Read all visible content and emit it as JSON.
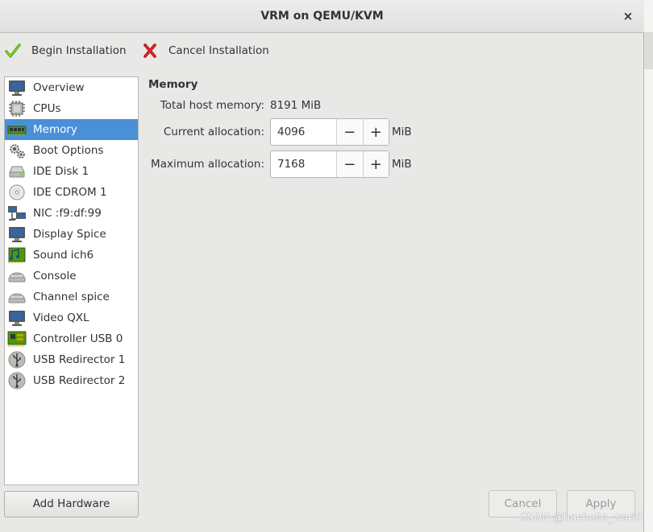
{
  "window": {
    "title": "VRM on QEMU/KVM",
    "close_glyph": "×"
  },
  "toolbar": {
    "begin_label": "Begin Installation",
    "cancel_label": "Cancel Installation",
    "begin_icon": "green-checkmark-icon",
    "cancel_icon": "red-x-icon"
  },
  "sidebar": {
    "items": [
      {
        "label": "Overview",
        "icon": "monitor-icon"
      },
      {
        "label": "CPUs",
        "icon": "cpu-chip-icon"
      },
      {
        "label": "Memory",
        "icon": "memory-module-icon",
        "selected": true
      },
      {
        "label": "Boot Options",
        "icon": "gears-icon"
      },
      {
        "label": "IDE Disk 1",
        "icon": "hard-disk-icon"
      },
      {
        "label": "IDE CDROM 1",
        "icon": "cdrom-icon"
      },
      {
        "label": "NIC :f9:df:99",
        "icon": "network-icon"
      },
      {
        "label": "Display Spice",
        "icon": "display-icon"
      },
      {
        "label": "Sound ich6",
        "icon": "sound-card-icon"
      },
      {
        "label": "Console",
        "icon": "serial-console-icon"
      },
      {
        "label": "Channel spice",
        "icon": "channel-icon"
      },
      {
        "label": "Video QXL",
        "icon": "video-monitor-icon"
      },
      {
        "label": "Controller USB 0",
        "icon": "controller-card-icon"
      },
      {
        "label": "USB Redirector 1",
        "icon": "usb-icon"
      },
      {
        "label": "USB Redirector 2",
        "icon": "usb-icon"
      }
    ],
    "selected_color": "#4a90d9",
    "add_hardware_label": "Add Hardware"
  },
  "memory": {
    "section_title": "Memory",
    "total_label": "Total host memory:",
    "total_value": "8191 MiB",
    "current_label": "Current allocation:",
    "current_value": "4096",
    "maximum_label": "Maximum allocation:",
    "maximum_value": "7168",
    "unit": "MiB",
    "minus_glyph": "−",
    "plus_glyph": "+"
  },
  "footer": {
    "cancel_label": "Cancel",
    "apply_label": "Apply"
  },
  "watermark": "CSDN @hachello_world"
}
